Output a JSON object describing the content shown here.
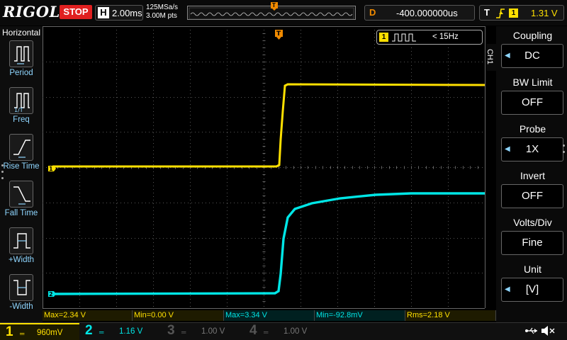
{
  "top": {
    "brand": "RIGOL",
    "run_state": "STOP",
    "timebase_label": "H",
    "timebase_value": "2.00ms",
    "sample_rate": "125MSa/s",
    "memory_depth": "3.00M pts",
    "trigger_marker": "T",
    "delay_label": "D",
    "delay_value": "-400.000000us",
    "trigger_label": "T",
    "trigger_edge": "ꜰ",
    "trigger_channel": "1",
    "trigger_level": "1.31 V"
  },
  "left_menu": {
    "title": "Horizontal",
    "items": [
      {
        "label": "Period",
        "icon": "period-icon"
      },
      {
        "label": "Freq",
        "icon": "frequency-icon"
      },
      {
        "label": "Rise Time",
        "icon": "rise-time-icon"
      },
      {
        "label": "Fall Time",
        "icon": "fall-time-icon"
      },
      {
        "label": "+Width",
        "icon": "positive-width-icon"
      },
      {
        "label": "-Width",
        "icon": "negative-width-icon"
      }
    ]
  },
  "screen": {
    "freq_channel": "1",
    "freq_value": "< 15Hz",
    "ch1_marker": "1",
    "ch2_marker": "2",
    "trigger_level_marker": "T",
    "colors": {
      "ch1": "#ffe000",
      "ch2": "#00e6e6",
      "ch3": "#c040c0",
      "ch4": "#4a7fd0",
      "trigger": "#f08a00"
    }
  },
  "measurements": [
    {
      "text": "Max=2.34 V",
      "channel": "ch1"
    },
    {
      "text": "Min=0.00 V",
      "channel": "ch1"
    },
    {
      "text": "Max=3.34 V",
      "channel": "ch2"
    },
    {
      "text": "Min=-92.8mV",
      "channel": "ch2"
    },
    {
      "text": "Rms=2.18 V",
      "channel": "ch1"
    }
  ],
  "channels": [
    {
      "num": "1",
      "scale": "960mV",
      "color": "#ffe000",
      "active": true
    },
    {
      "num": "2",
      "scale": "1.16 V",
      "color": "#00e6e6",
      "active": false
    },
    {
      "num": "3",
      "scale": "1.00 V",
      "color": "#777777",
      "active": false
    },
    {
      "num": "4",
      "scale": "1.00 V",
      "color": "#777777",
      "active": false
    }
  ],
  "right_menu": {
    "tab": "CH1",
    "items": [
      {
        "title": "Coupling",
        "value": "DC",
        "has_arrow": true
      },
      {
        "title": "BW Limit",
        "value": "OFF",
        "has_arrow": false
      },
      {
        "title": "Probe",
        "value": "1X",
        "has_arrow": true
      },
      {
        "title": "Invert",
        "value": "OFF",
        "has_arrow": false
      },
      {
        "title": "Volts/Div",
        "value": "Fine",
        "has_arrow": false
      },
      {
        "title": "Unit",
        "value": "[V]",
        "has_arrow": true
      }
    ]
  },
  "status": {
    "usb_icon": "usb-icon",
    "sound_icon": "speaker-icon"
  }
}
